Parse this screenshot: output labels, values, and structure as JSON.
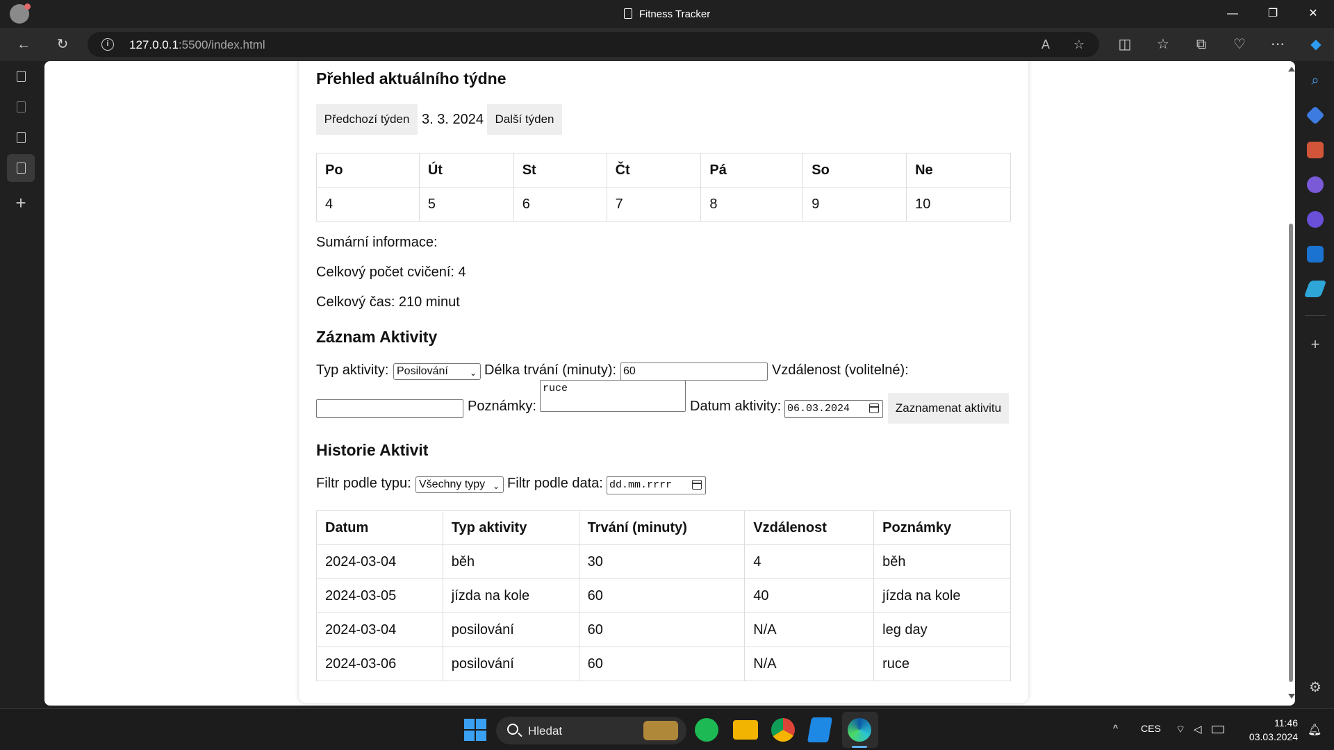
{
  "window": {
    "title": "Fitness Tracker",
    "minimize": "—",
    "maximize": "❐",
    "close": "✕"
  },
  "browser": {
    "url_host": "127.0.0.1",
    "url_rest": ":5500/index.html",
    "back": "←",
    "reload": "↻",
    "add_tab": "+"
  },
  "week": {
    "title": "Přehled aktuálního týdne",
    "prev_label": "Předchozí týden",
    "date": "3. 3. 2024",
    "next_label": "Další týden",
    "days": [
      "Po",
      "Út",
      "St",
      "Čt",
      "Pá",
      "So",
      "Ne"
    ],
    "dates": [
      "4",
      "5",
      "6",
      "7",
      "8",
      "9",
      "10"
    ]
  },
  "summary": {
    "heading": "Sumární informace:",
    "count": "Celkový počet cvičení: 4",
    "time": "Celkový čas: 210 minut"
  },
  "record": {
    "title": "Záznam Aktivity",
    "type_label": "Typ aktivity:",
    "type_value": "Posilování",
    "duration_label": "Délka trvání (minuty):",
    "duration_value": "60",
    "distance_label": "Vzdálenost (volitelné):",
    "distance_value": "",
    "notes_label": "Poznámky:",
    "notes_value": "ruce",
    "date_label": "Datum aktivity:",
    "date_value": "06.03.2024",
    "submit_label": "Zaznamenat aktivitu"
  },
  "history": {
    "title": "Historie Aktivit",
    "filter_type_label": "Filtr podle typu:",
    "filter_type_value": "Všechny typy",
    "filter_date_label": "Filtr podle data:",
    "filter_date_value": "dd.mm.rrrr",
    "columns": [
      "Datum",
      "Typ aktivity",
      "Trvání (minuty)",
      "Vzdálenost",
      "Poznámky"
    ],
    "rows": [
      [
        "2024-03-04",
        "běh",
        "30",
        "4",
        "běh"
      ],
      [
        "2024-03-05",
        "jízda na kole",
        "60",
        "40",
        "jízda na kole"
      ],
      [
        "2024-03-04",
        "posilování",
        "60",
        "N/A",
        "leg day"
      ],
      [
        "2024-03-06",
        "posilování",
        "60",
        "N/A",
        "ruce"
      ]
    ]
  },
  "taskbar": {
    "search_label": "Hledat",
    "language": "CES",
    "time": "11:46",
    "date": "03.03.2024",
    "chevron": "^"
  },
  "colors": {
    "browser_bg": "#202020",
    "page_bg": "#ffffff",
    "button_bg": "#eeeeee",
    "table_border": "#dddddd"
  }
}
